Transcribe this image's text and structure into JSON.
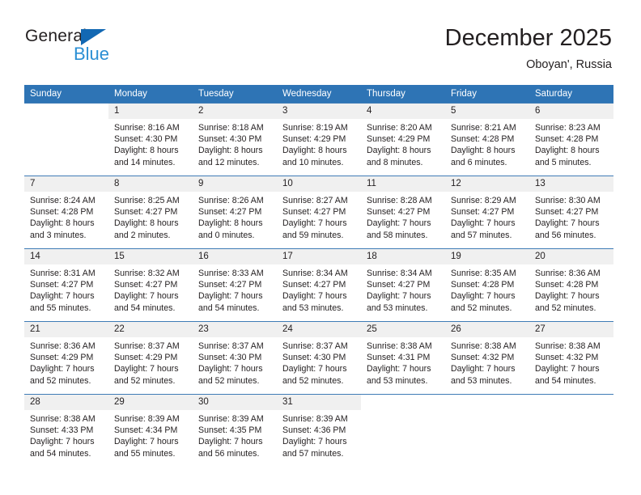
{
  "brand": {
    "name_top": "General",
    "name_bottom": "Blue",
    "accent_color": "#1268b3",
    "accent_color_light": "#2b8fd4"
  },
  "header": {
    "title": "December 2025",
    "subtitle": "Oboyan', Russia"
  },
  "theme": {
    "header_row_bg": "#2e74b5",
    "header_row_text": "#ffffff",
    "daynum_bg": "#f0f0f0",
    "grid_line": "#3f7cb6",
    "body_text": "#231f20"
  },
  "weekday_headers": [
    "Sunday",
    "Monday",
    "Tuesday",
    "Wednesday",
    "Thursday",
    "Friday",
    "Saturday"
  ],
  "labels": {
    "sunrise_prefix": "Sunrise:",
    "sunset_prefix": "Sunset:",
    "daylight_prefix": "Daylight:"
  },
  "weeks": [
    [
      {
        "day": "",
        "lines": []
      },
      {
        "day": "1",
        "lines": [
          "Sunrise: 8:16 AM",
          "Sunset: 4:30 PM",
          "Daylight: 8 hours",
          "and 14 minutes."
        ]
      },
      {
        "day": "2",
        "lines": [
          "Sunrise: 8:18 AM",
          "Sunset: 4:30 PM",
          "Daylight: 8 hours",
          "and 12 minutes."
        ]
      },
      {
        "day": "3",
        "lines": [
          "Sunrise: 8:19 AM",
          "Sunset: 4:29 PM",
          "Daylight: 8 hours",
          "and 10 minutes."
        ]
      },
      {
        "day": "4",
        "lines": [
          "Sunrise: 8:20 AM",
          "Sunset: 4:29 PM",
          "Daylight: 8 hours",
          "and 8 minutes."
        ]
      },
      {
        "day": "5",
        "lines": [
          "Sunrise: 8:21 AM",
          "Sunset: 4:28 PM",
          "Daylight: 8 hours",
          "and 6 minutes."
        ]
      },
      {
        "day": "6",
        "lines": [
          "Sunrise: 8:23 AM",
          "Sunset: 4:28 PM",
          "Daylight: 8 hours",
          "and 5 minutes."
        ]
      }
    ],
    [
      {
        "day": "7",
        "lines": [
          "Sunrise: 8:24 AM",
          "Sunset: 4:28 PM",
          "Daylight: 8 hours",
          "and 3 minutes."
        ]
      },
      {
        "day": "8",
        "lines": [
          "Sunrise: 8:25 AM",
          "Sunset: 4:27 PM",
          "Daylight: 8 hours",
          "and 2 minutes."
        ]
      },
      {
        "day": "9",
        "lines": [
          "Sunrise: 8:26 AM",
          "Sunset: 4:27 PM",
          "Daylight: 8 hours",
          "and 0 minutes."
        ]
      },
      {
        "day": "10",
        "lines": [
          "Sunrise: 8:27 AM",
          "Sunset: 4:27 PM",
          "Daylight: 7 hours",
          "and 59 minutes."
        ]
      },
      {
        "day": "11",
        "lines": [
          "Sunrise: 8:28 AM",
          "Sunset: 4:27 PM",
          "Daylight: 7 hours",
          "and 58 minutes."
        ]
      },
      {
        "day": "12",
        "lines": [
          "Sunrise: 8:29 AM",
          "Sunset: 4:27 PM",
          "Daylight: 7 hours",
          "and 57 minutes."
        ]
      },
      {
        "day": "13",
        "lines": [
          "Sunrise: 8:30 AM",
          "Sunset: 4:27 PM",
          "Daylight: 7 hours",
          "and 56 minutes."
        ]
      }
    ],
    [
      {
        "day": "14",
        "lines": [
          "Sunrise: 8:31 AM",
          "Sunset: 4:27 PM",
          "Daylight: 7 hours",
          "and 55 minutes."
        ]
      },
      {
        "day": "15",
        "lines": [
          "Sunrise: 8:32 AM",
          "Sunset: 4:27 PM",
          "Daylight: 7 hours",
          "and 54 minutes."
        ]
      },
      {
        "day": "16",
        "lines": [
          "Sunrise: 8:33 AM",
          "Sunset: 4:27 PM",
          "Daylight: 7 hours",
          "and 54 minutes."
        ]
      },
      {
        "day": "17",
        "lines": [
          "Sunrise: 8:34 AM",
          "Sunset: 4:27 PM",
          "Daylight: 7 hours",
          "and 53 minutes."
        ]
      },
      {
        "day": "18",
        "lines": [
          "Sunrise: 8:34 AM",
          "Sunset: 4:27 PM",
          "Daylight: 7 hours",
          "and 53 minutes."
        ]
      },
      {
        "day": "19",
        "lines": [
          "Sunrise: 8:35 AM",
          "Sunset: 4:28 PM",
          "Daylight: 7 hours",
          "and 52 minutes."
        ]
      },
      {
        "day": "20",
        "lines": [
          "Sunrise: 8:36 AM",
          "Sunset: 4:28 PM",
          "Daylight: 7 hours",
          "and 52 minutes."
        ]
      }
    ],
    [
      {
        "day": "21",
        "lines": [
          "Sunrise: 8:36 AM",
          "Sunset: 4:29 PM",
          "Daylight: 7 hours",
          "and 52 minutes."
        ]
      },
      {
        "day": "22",
        "lines": [
          "Sunrise: 8:37 AM",
          "Sunset: 4:29 PM",
          "Daylight: 7 hours",
          "and 52 minutes."
        ]
      },
      {
        "day": "23",
        "lines": [
          "Sunrise: 8:37 AM",
          "Sunset: 4:30 PM",
          "Daylight: 7 hours",
          "and 52 minutes."
        ]
      },
      {
        "day": "24",
        "lines": [
          "Sunrise: 8:37 AM",
          "Sunset: 4:30 PM",
          "Daylight: 7 hours",
          "and 52 minutes."
        ]
      },
      {
        "day": "25",
        "lines": [
          "Sunrise: 8:38 AM",
          "Sunset: 4:31 PM",
          "Daylight: 7 hours",
          "and 53 minutes."
        ]
      },
      {
        "day": "26",
        "lines": [
          "Sunrise: 8:38 AM",
          "Sunset: 4:32 PM",
          "Daylight: 7 hours",
          "and 53 minutes."
        ]
      },
      {
        "day": "27",
        "lines": [
          "Sunrise: 8:38 AM",
          "Sunset: 4:32 PM",
          "Daylight: 7 hours",
          "and 54 minutes."
        ]
      }
    ],
    [
      {
        "day": "28",
        "lines": [
          "Sunrise: 8:38 AM",
          "Sunset: 4:33 PM",
          "Daylight: 7 hours",
          "and 54 minutes."
        ]
      },
      {
        "day": "29",
        "lines": [
          "Sunrise: 8:39 AM",
          "Sunset: 4:34 PM",
          "Daylight: 7 hours",
          "and 55 minutes."
        ]
      },
      {
        "day": "30",
        "lines": [
          "Sunrise: 8:39 AM",
          "Sunset: 4:35 PM",
          "Daylight: 7 hours",
          "and 56 minutes."
        ]
      },
      {
        "day": "31",
        "lines": [
          "Sunrise: 8:39 AM",
          "Sunset: 4:36 PM",
          "Daylight: 7 hours",
          "and 57 minutes."
        ]
      },
      {
        "day": "",
        "lines": []
      },
      {
        "day": "",
        "lines": []
      },
      {
        "day": "",
        "lines": []
      }
    ]
  ]
}
